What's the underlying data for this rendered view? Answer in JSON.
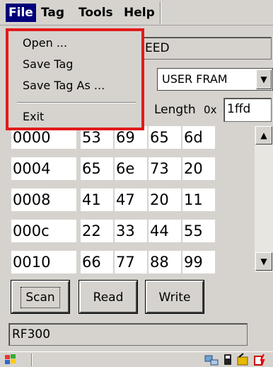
{
  "menubar": {
    "file": "File",
    "tag": "Tag",
    "tools": "Tools",
    "help": "Help"
  },
  "file_menu": {
    "open": "Open ...",
    "save_tag": "Save Tag",
    "save_tag_as": "Save Tag As ...",
    "exit": "Exit"
  },
  "top_field_text": "EED",
  "memory_select": "USER FRAM",
  "length_label": "Length",
  "length_prefix": "0x",
  "length_value": "1ffd",
  "hex_grid": [
    {
      "addr": "0000",
      "bytes": [
        "53",
        "69",
        "65",
        "6d"
      ]
    },
    {
      "addr": "0004",
      "bytes": [
        "65",
        "6e",
        "73",
        "20"
      ]
    },
    {
      "addr": "0008",
      "bytes": [
        "41",
        "47",
        "20",
        "11"
      ]
    },
    {
      "addr": "000c",
      "bytes": [
        "22",
        "33",
        "44",
        "55"
      ]
    },
    {
      "addr": "0010",
      "bytes": [
        "66",
        "77",
        "88",
        "99"
      ]
    }
  ],
  "buttons": {
    "scan": "Scan",
    "read": "Read",
    "write": "Write"
  },
  "status_text": "RF300",
  "colors": {
    "menu_highlight": "#00007a",
    "dropdown_outline": "#e21a1a",
    "window_background": "#d6d3ce"
  }
}
